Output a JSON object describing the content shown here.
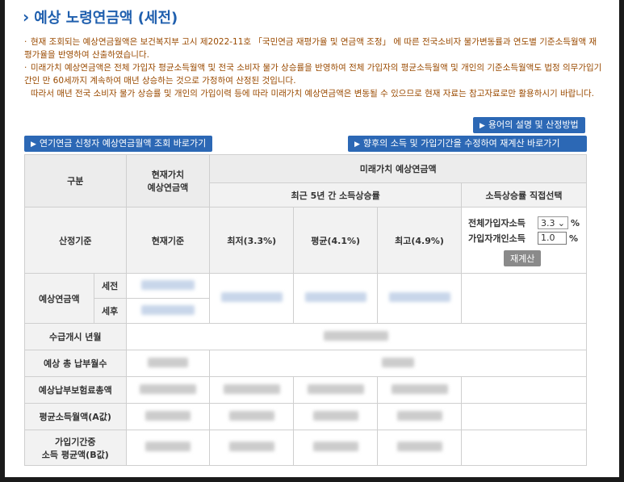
{
  "title": "예상 노령연금액 (세전)",
  "notes": [
    "현재 조회되는 예상연금월액은 보건복지부 고시 제2022-11호 「국민연금 재평가율 및 연금액 조정」 에 따른 전국소비자 물가변동률과 연도별 기준소득월액 재평가율을 반영하여 산출하였습니다.",
    "미래가치 예상연금액은 전체 가입자 평균소득월액 및 전국 소비자 물가 상승률을 반영하여 전체 가입자의 평균소득월액 및 개인의 기준소득월액도 법정 의무가입기간인 만 60세까지 계속하여 매년 상승하는 것으로 가정하여 산정된 것입니다.",
    "따라서 매년 전국 소비자 물가 상승률 및 개인의 가입이력 등에 따라 미래가치 예상연금액은 변동될 수 있으므로 현재 자료는 참고자료로만 활용하시기 바랍니다."
  ],
  "buttons": {
    "terms": "용어의 설명 및 산정방법",
    "deferred": "연기연금 신청자 예상연금월액 조회 바로가기",
    "modify": "향후의 소득 및 가입기간을 수정하여 재계산 바로가기"
  },
  "table": {
    "h_category": "구분",
    "h_present": "현재가치\n예상연금액",
    "h_future": "미래가치 예상연금액",
    "h_recent": "최근 5년 간 소득상승률",
    "h_direct": "소득상승률 직접선택",
    "basis_label": "산정기준",
    "basis_present": "현재기준",
    "basis_low": "최저(3.3%)",
    "basis_avg": "평균(4.1%)",
    "basis_high": "최고(4.9%)",
    "calc": {
      "all_label": "전체가입자소득",
      "all_value": "3.3",
      "personal_label": "가입자개인소득",
      "personal_value": "1.0",
      "pct": "%",
      "recalc": "재계산"
    },
    "rows": {
      "expected": "예상연금액",
      "pretax": "세전",
      "aftertax": "세후",
      "start": "수급개시 년월",
      "months": "예상 총 납부월수",
      "total_paid": "예상납부보험료총액",
      "avg_a": "평균소득월액(A값)",
      "avg_b_1": "가입기간중",
      "avg_b_2": "소득 평균액(B값)"
    }
  }
}
